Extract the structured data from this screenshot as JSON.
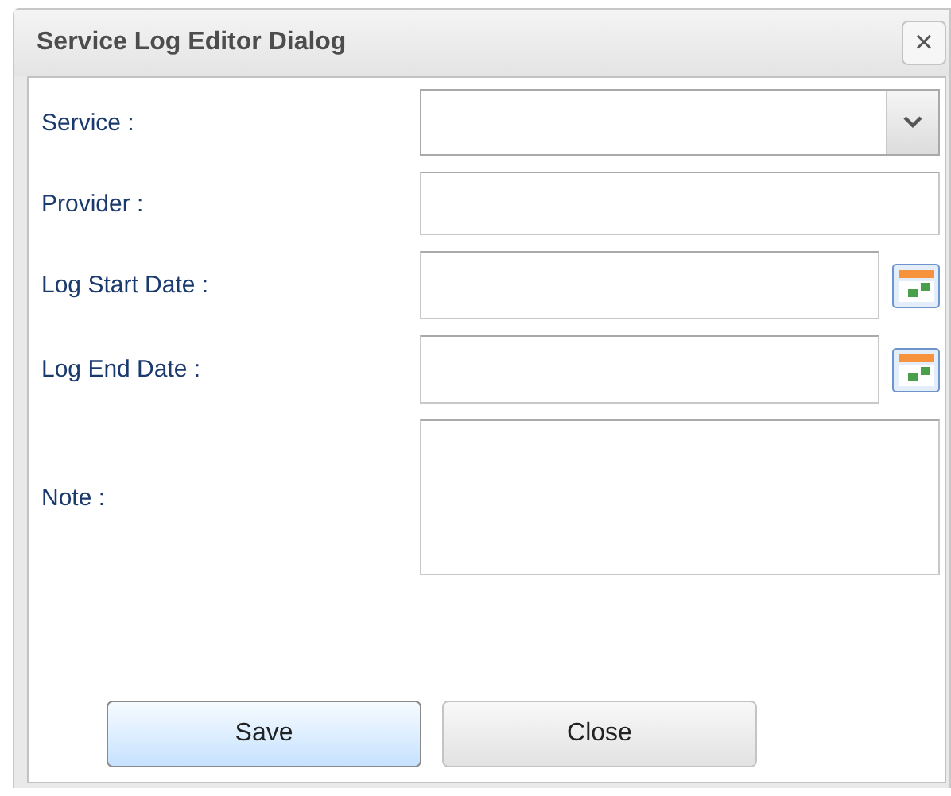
{
  "window": {
    "title": "Service Log Editor Dialog",
    "close_label": "×"
  },
  "fields": [
    {
      "label": "Service :",
      "kind": "select"
    },
    {
      "label": "Provider :",
      "kind": "text"
    },
    {
      "label": "Log Start Date :",
      "kind": "date"
    },
    {
      "label": "Log End Date :",
      "kind": "date"
    },
    {
      "label": "Note :",
      "kind": "textarea"
    }
  ],
  "buttons": [
    {
      "label": "Save",
      "focused": true
    },
    {
      "label": "Close",
      "focused": false
    }
  ]
}
